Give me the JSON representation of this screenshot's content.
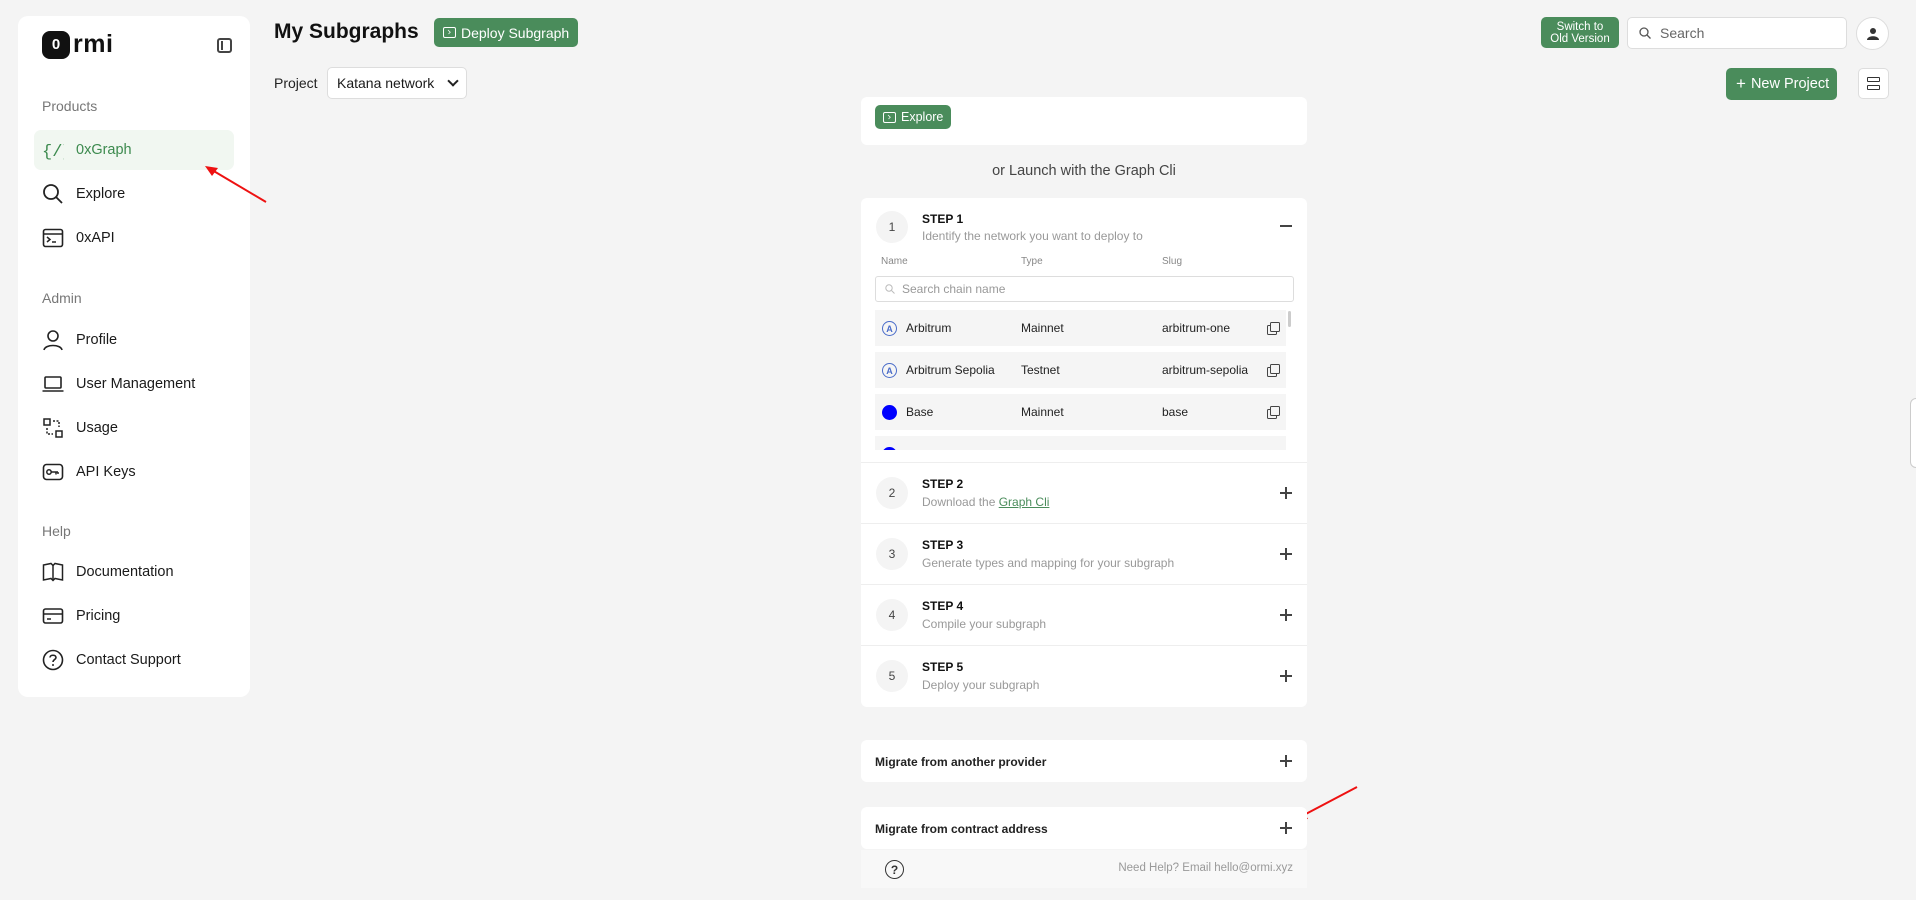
{
  "logo": {
    "badge": "0",
    "text": "rmi"
  },
  "sidebar": {
    "sections": [
      {
        "label": "Products"
      },
      {
        "label": "Admin"
      },
      {
        "label": "Help"
      }
    ],
    "items": [
      {
        "label": "0xGraph",
        "icon": "code-braces-icon"
      },
      {
        "label": "Explore",
        "icon": "search-icon"
      },
      {
        "label": "0xAPI",
        "icon": "terminal-icon"
      },
      {
        "label": "Profile",
        "icon": "user-icon"
      },
      {
        "label": "User Management",
        "icon": "laptop-icon"
      },
      {
        "label": "Usage",
        "icon": "usage-icon"
      },
      {
        "label": "API Keys",
        "icon": "key-icon"
      },
      {
        "label": "Documentation",
        "icon": "book-icon"
      },
      {
        "label": "Pricing",
        "icon": "credit-card-icon"
      },
      {
        "label": "Contact Support",
        "icon": "question-circle-icon"
      }
    ]
  },
  "header": {
    "title": "My Subgraphs",
    "deploy_label": "Deploy Subgraph",
    "project_label": "Project",
    "project_value": "Katana network",
    "switch_line1": "Switch to",
    "switch_line2": "Old Version",
    "search_placeholder": "Search",
    "new_project_label": "New Project"
  },
  "main": {
    "explore_label": "Explore",
    "launch_text": "or Launch with the Graph Cli",
    "columns": {
      "name": "Name",
      "type": "Type",
      "slug": "Slug"
    },
    "chain_search_placeholder": "Search chain name",
    "chains": [
      {
        "name": "Arbitrum",
        "type": "Mainnet",
        "slug": "arbitrum-one",
        "icon": "arbitrum-icon"
      },
      {
        "name": "Arbitrum Sepolia",
        "type": "Testnet",
        "slug": "arbitrum-sepolia",
        "icon": "arbitrum-icon"
      },
      {
        "name": "Base",
        "type": "Mainnet",
        "slug": "base",
        "icon": "base-icon"
      }
    ],
    "steps": [
      {
        "num": "1",
        "title": "STEP 1",
        "desc": "Identify the network you want to deploy to"
      },
      {
        "num": "2",
        "title": "STEP 2",
        "desc": "Download the ",
        "link": "Graph Cli"
      },
      {
        "num": "3",
        "title": "STEP 3",
        "desc": "Generate types and mapping for your subgraph"
      },
      {
        "num": "4",
        "title": "STEP 4",
        "desc": "Compile your subgraph"
      },
      {
        "num": "5",
        "title": "STEP 5",
        "desc": "Deploy your subgraph"
      }
    ],
    "migrate_provider": "Migrate from another provider",
    "migrate_contract": "Migrate from contract address",
    "help_text": "Need Help?   Email hello@ormi.xyz"
  }
}
